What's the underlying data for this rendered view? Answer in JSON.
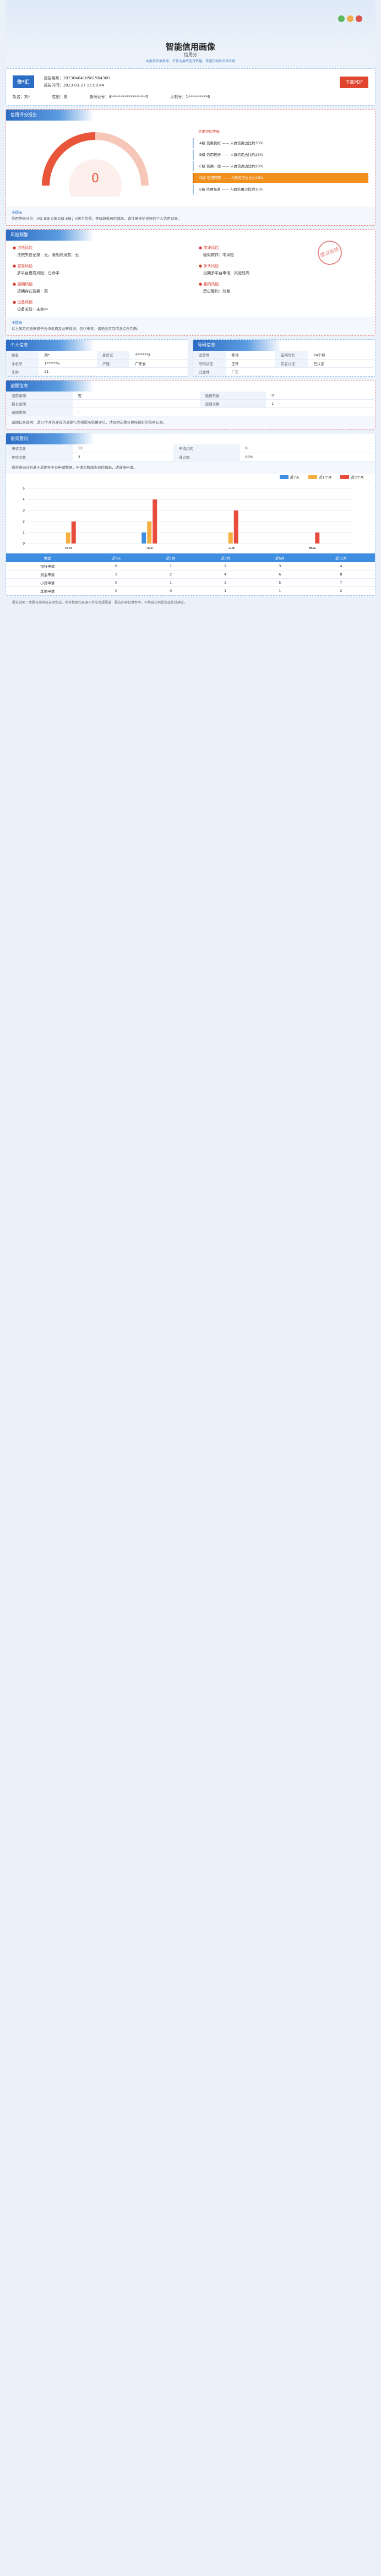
{
  "header": {
    "title": "智能信用画像",
    "subtitle": "信用分",
    "note": "本报告仅供参考，不作为最终信贷依据，请遵守相关法律法规"
  },
  "report": {
    "brand": "信*汇",
    "no_label": "报告编号：",
    "no": "2023040418561964300",
    "date_label": "报告时间：",
    "date": "2023-03-27 15:08:44",
    "pdf": "下载PDF",
    "name_label": "姓名：",
    "name": "刘*",
    "gender_label": "性别：",
    "gender": "男",
    "id_label": "身份证号：",
    "id": "4******************5",
    "phone_label": "手机号：",
    "phone": "1**********6"
  },
  "score": {
    "header": "信用评分报告",
    "value": "0",
    "tip_title": "小提示",
    "tip": "信用等级分为：A级 B级 C级 D级 E级；A级为优秀，等级越低风险越高，请注意维护良好的个人信用记录。",
    "levels": [
      "信用评估等级",
      "A级 信用良好 —— 人群信用占比约30%",
      "B级 信用较好 —— 人群信用占比约25%",
      "C级 信用一般 —— 人群信用占比约20%",
      "D级 信用较差 —— 人群信用占比约15%",
      "E级 信用极差 —— 人群信用占比约10%"
    ],
    "active": 4
  },
  "risk": {
    "header": "风险预警",
    "stamp": "建议拒绝",
    "items": [
      {
        "t": "涉黑风险",
        "v": "法院失信记录：无，限制高消费：无"
      },
      {
        "t": "欺诈风险",
        "v": "疑似欺诈：中风险"
      },
      {
        "t": "监管风险",
        "v": "多平台借贷风险：已命中"
      },
      {
        "t": "多头风险",
        "v": "近期多平台申请：风险较高"
      },
      {
        "t": "逾期风险",
        "v": "近期存在逾期：高"
      },
      {
        "t": "履约风险",
        "v": "历史履约：较差"
      },
      {
        "t": "设备风险",
        "v": "设备关联：未命中"
      }
    ],
    "tip_title": "小提示",
    "tip": "以上风险信息来源于合作机构及公开数据，仅供参考，请结合实际情况综合判断。"
  },
  "basic": {
    "header": "个人信息",
    "rows": [
      [
        "姓名",
        "刘*"
      ],
      [
        "身份证",
        "4******5"
      ],
      [
        "手机号",
        "1******6"
      ],
      [
        "户籍",
        "广东省"
      ],
      [
        "年龄",
        "31"
      ]
    ],
    "card_header": "号码信息",
    "card_rows": [
      [
        "运营商",
        "移动"
      ],
      [
        "在网时长",
        "24个月"
      ],
      [
        "号码状态",
        "正常"
      ],
      [
        "实名认证",
        "已认证"
      ],
      [
        "归属地",
        "广东"
      ]
    ]
  },
  "overdue": {
    "header": "逾期信息",
    "rows": [
      [
        "当前逾期",
        "否"
      ],
      [
        "逾期天数",
        "0"
      ],
      [
        "最长逾期",
        "-"
      ],
      [
        "逾期次数",
        "1"
      ],
      [
        "逾期金额",
        "-"
      ]
    ],
    "tip": "逾期记录说明：近12个月内存在的逾期行为将影响信用评分，请及时还款以保持良好的信用记录。"
  },
  "apply": {
    "header": "借贷意向",
    "stats": [
      [
        "申请次数",
        "12"
      ],
      [
        "申请机构",
        "8"
      ],
      [
        "拒绝次数",
        "3"
      ],
      [
        "通过率",
        "60%"
      ]
    ],
    "tip": "借贷意向分析基于近期各平台申请数据，申请次数越多风险越高，请谨慎申请。",
    "legend": [
      "近7天",
      "近1个月",
      "近3个月"
    ],
    "cats": [
      "银行",
      "消金",
      "小贷",
      "其他"
    ],
    "table_head": [
      "类型",
      "近7天",
      "近1月",
      "近3月",
      "近6月",
      "近12月"
    ],
    "table": [
      [
        "银行申请",
        "0",
        "1",
        "2",
        "3",
        "4"
      ],
      [
        "消金申请",
        "1",
        "2",
        "4",
        "6",
        "8"
      ],
      [
        "小贷申请",
        "0",
        "1",
        "3",
        "5",
        "7"
      ],
      [
        "其他申请",
        "0",
        "0",
        "1",
        "1",
        "2"
      ]
    ]
  },
  "chart_data": {
    "type": "bar",
    "categories": [
      "银行",
      "消金",
      "小贷",
      "其他"
    ],
    "series": [
      {
        "name": "近7天",
        "values": [
          0,
          1,
          0,
          0
        ]
      },
      {
        "name": "近1个月",
        "values": [
          1,
          2,
          1,
          0
        ]
      },
      {
        "name": "近3个月",
        "values": [
          2,
          4,
          3,
          1
        ]
      }
    ]
  },
  "footer": "报告说明：本报告由系统自动生成，所有数据均来源于合法合规渠道，报告内容仅供参考，不构成任何投资或信贷建议。"
}
